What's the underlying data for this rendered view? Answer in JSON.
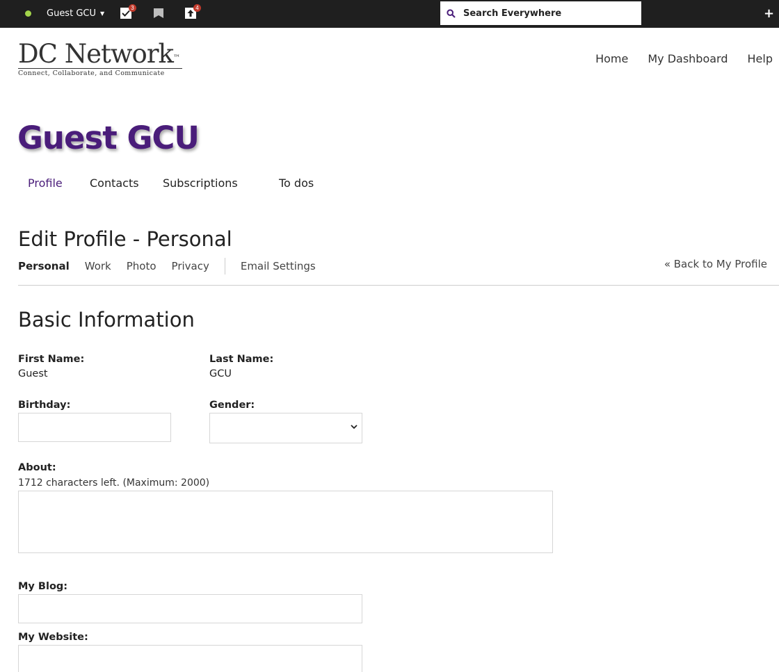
{
  "topbar": {
    "user_name": "Guest GCU",
    "tasks_badge": "3",
    "uploads_badge": "4",
    "search_placeholder": "Search Everywhere",
    "icons": [
      "status-dot",
      "tasks-icon",
      "flag-icon",
      "upload-icon",
      "search-icon",
      "plus-icon"
    ]
  },
  "logo": {
    "title": "DC Network",
    "trademark": "™",
    "tagline": "Connect, Collaborate, and Communicate"
  },
  "main_nav": [
    "Home",
    "My Dashboard",
    "Help"
  ],
  "profile": {
    "name": "Guest GCU",
    "tabs": [
      "Profile",
      "Contacts",
      "Subscriptions",
      "To dos"
    ],
    "active_tab": "Profile"
  },
  "edit": {
    "title": "Edit Profile - Personal",
    "subnav": [
      "Personal",
      "Work",
      "Photo",
      "Privacy",
      "Email Settings"
    ],
    "current": "Personal",
    "back_link": "« Back to My Profile"
  },
  "basic": {
    "section_title": "Basic Information",
    "first_name_label": "First Name:",
    "first_name_value": "Guest",
    "last_name_label": "Last Name:",
    "last_name_value": "GCU",
    "birthday_label": "Birthday:",
    "birthday_value": "",
    "gender_label": "Gender:",
    "gender_value": "",
    "about_label": "About:",
    "about_hint": "1712 characters left. (Maximum: 2000)",
    "about_value": "",
    "blog_label": "My Blog:",
    "blog_value": "",
    "website_label": "My Website:",
    "website_value": ""
  },
  "colors": {
    "topbar_bg": "#1f1f1f",
    "brand_purple": "#4a1d7a",
    "status_green": "#a3d44b",
    "badge_red": "#c0392b"
  }
}
